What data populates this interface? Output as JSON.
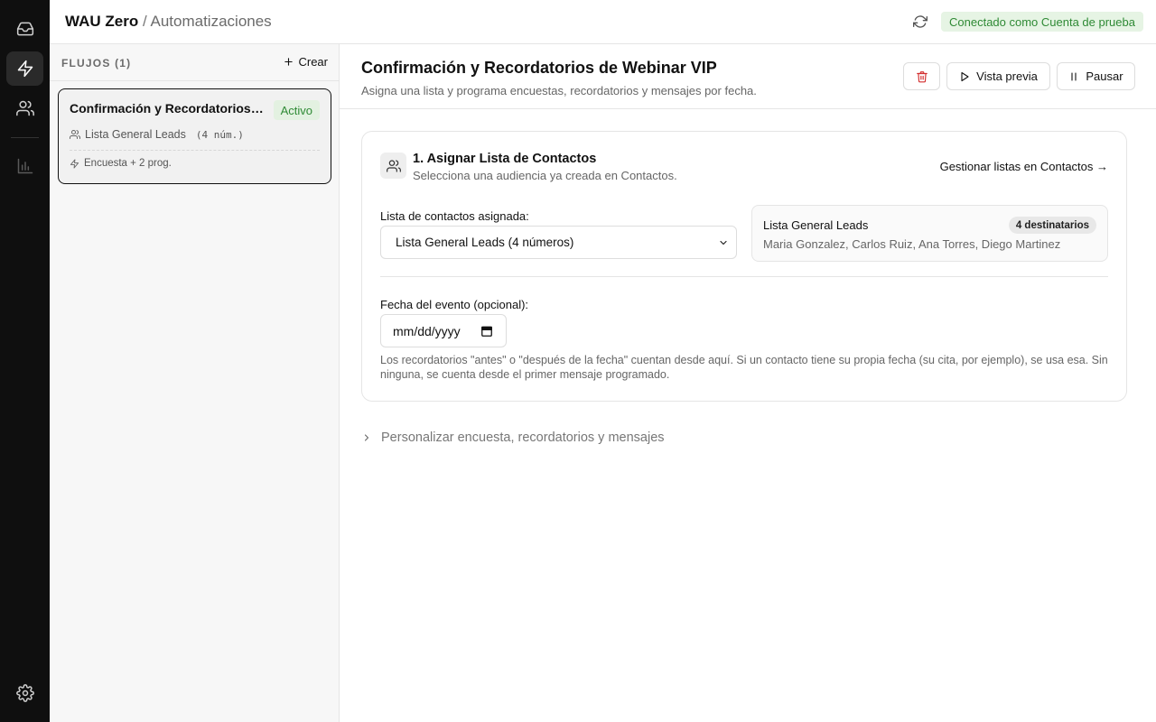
{
  "header": {
    "app_name": "WAU Zero",
    "separator": "/",
    "section": "Automatizaciones",
    "connection_status": "Conectado como Cuenta de prueba"
  },
  "rail": {
    "items": [
      {
        "icon": "inbox-icon",
        "active": false
      },
      {
        "icon": "lightning-icon",
        "active": true
      },
      {
        "icon": "users-icon",
        "active": false
      },
      {
        "icon": "bar-chart-icon",
        "active": false
      },
      {
        "icon": "gear-icon",
        "active": false
      }
    ]
  },
  "flows": {
    "title": "FLUJOS (1)",
    "create_label": "Crear",
    "items": [
      {
        "title": "Confirmación y Recordatorios de Webinar VIP",
        "status": "Activo",
        "list_name": "Lista General Leads",
        "list_count": "(4 núm.)",
        "meta": "Encuesta + 2 prog."
      }
    ]
  },
  "main": {
    "title": "Confirmación y Recordatorios de Webinar VIP",
    "subtitle": "Asigna una lista y programa encuestas, recordatorios y mensajes por fecha.",
    "preview_label": "Vista previa",
    "pause_label": "Pausar",
    "assign_card": {
      "title": "1. Asignar Lista de Contactos",
      "subtitle": "Selecciona una audiencia ya creada en Contactos.",
      "manage_link": "Gestionar listas en Contactos →",
      "list_label": "Lista de contactos asignada:",
      "list_selected": "Lista General Leads (4 números)",
      "summary": {
        "name": "Lista General Leads",
        "badge": "4 destinatarios",
        "members": "Maria Gonzalez, Carlos Ruiz, Ana Torres, Diego Martinez"
      },
      "date_label": "Fecha del evento (opcional):",
      "date_placeholder": "mm/dd/yyyy",
      "help_text": "Los recordatorios \"antes\" o \"después de la fecha\" cuentan desde aquí. Si un contacto tiene su propia fecha (su cita, por ejemplo), se usa esa. Sin ninguna, se cuenta desde el primer mensaje programado."
    },
    "customize_label": "Personalizar encuesta, recordatorios y mensajes"
  },
  "colors": {
    "rail_bg": "#0f0f0f",
    "status_green": "#2f8a35",
    "status_green_bg": "#e6f4e4",
    "delete_red": "#d32f2f"
  }
}
